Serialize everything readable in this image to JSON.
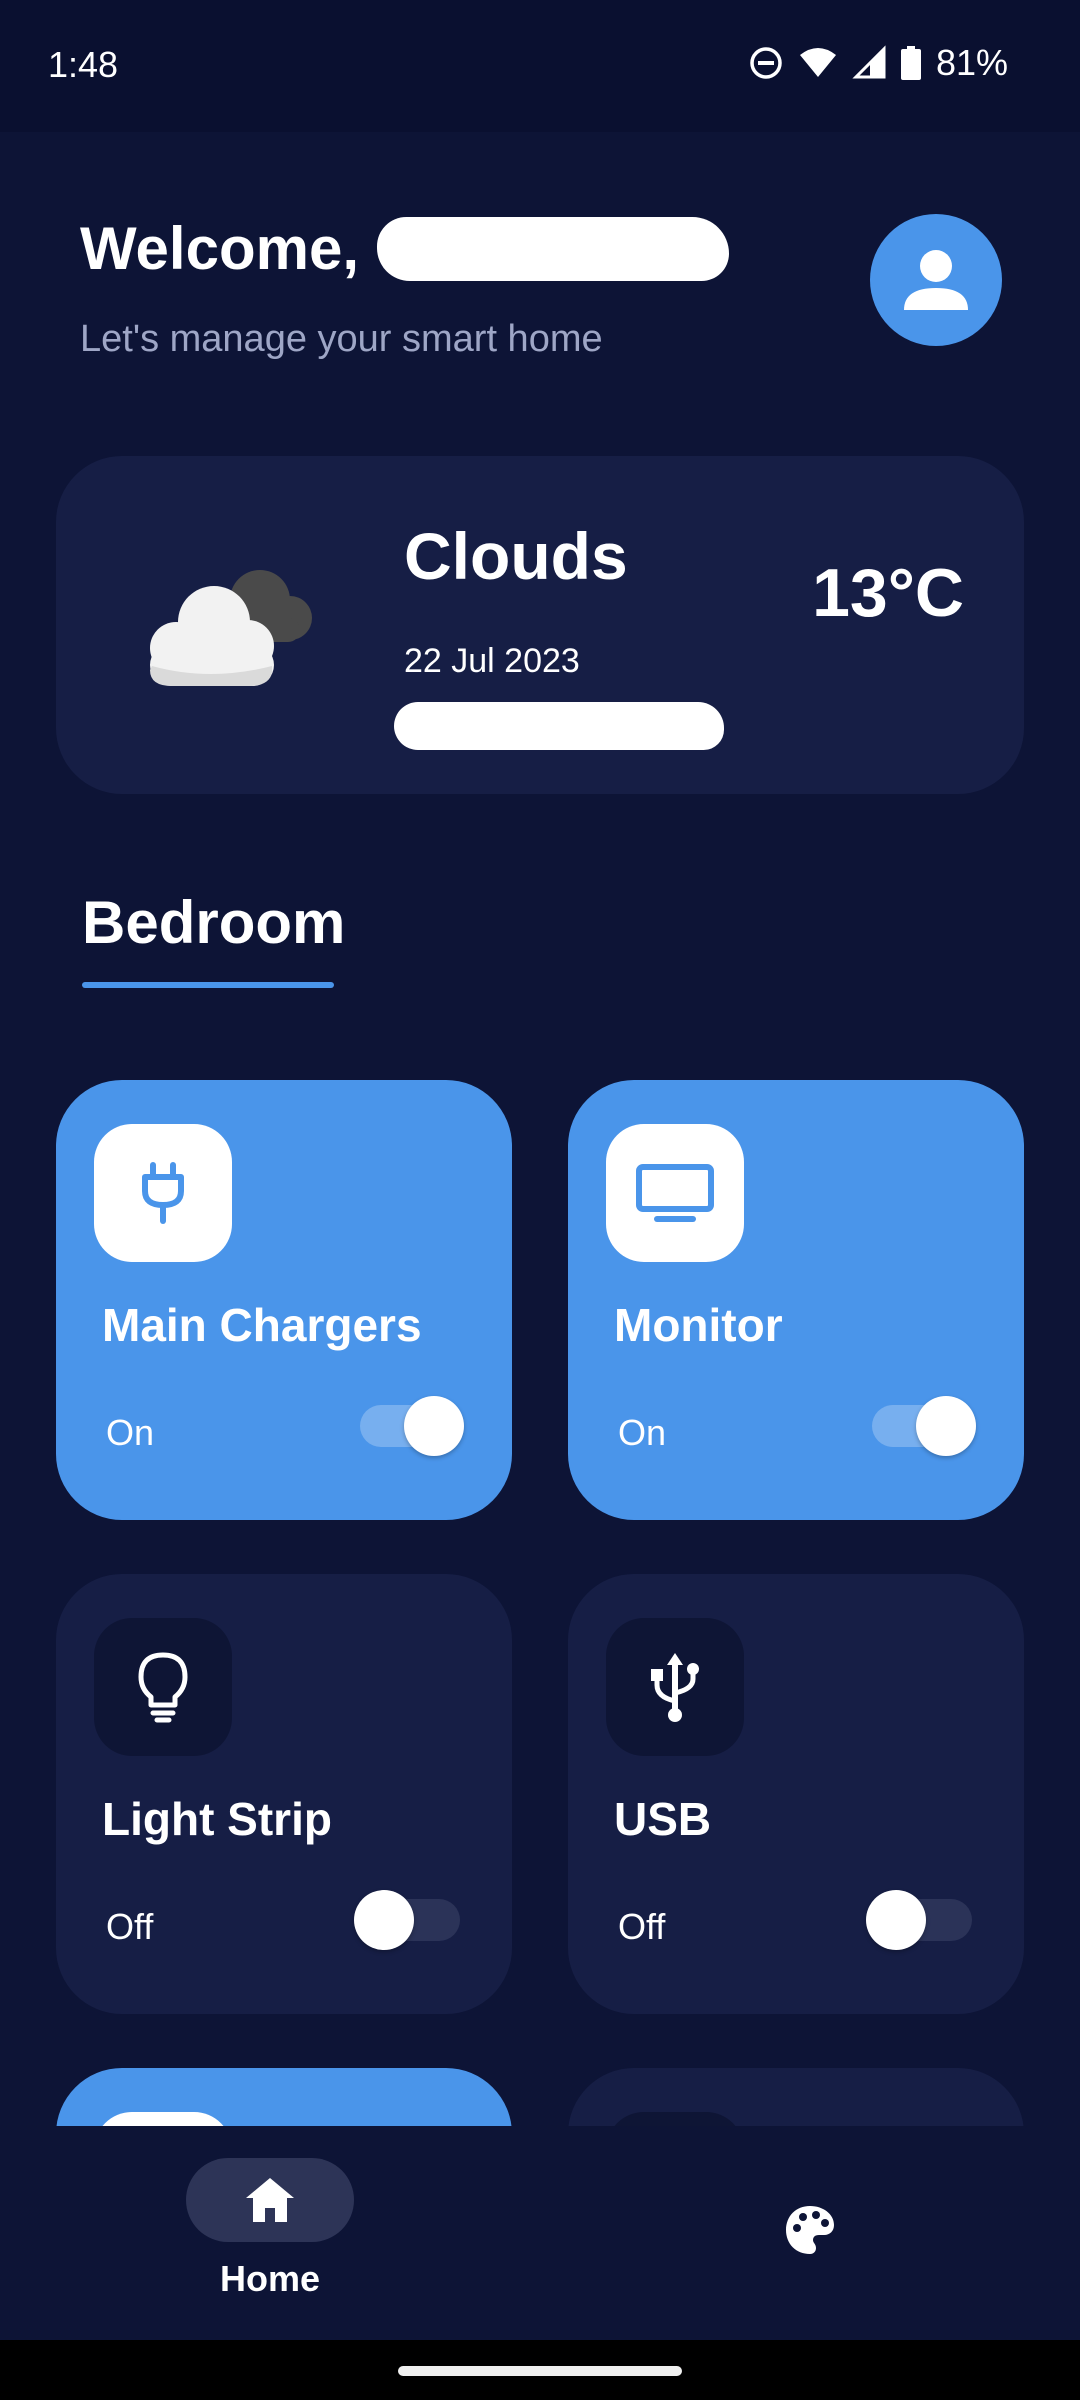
{
  "status_bar": {
    "time": "1:48",
    "battery": "81%"
  },
  "header": {
    "welcome": "Welcome,",
    "subtitle": "Let's manage your smart home"
  },
  "weather": {
    "condition": "Clouds",
    "date": "22 Jul 2023",
    "temperature": "13°C",
    "icon": "clouds-icon"
  },
  "room": {
    "name": "Bedroom"
  },
  "devices": [
    {
      "name": "Main Chargers",
      "state": "On",
      "on": true,
      "icon": "plug-icon"
    },
    {
      "name": "Monitor",
      "state": "On",
      "on": true,
      "icon": "monitor-icon"
    },
    {
      "name": "Light Strip",
      "state": "Off",
      "on": false,
      "icon": "lightbulb-icon"
    },
    {
      "name": "USB",
      "state": "Off",
      "on": false,
      "icon": "usb-icon"
    }
  ],
  "bottom_nav": {
    "home_label": "Home"
  },
  "colors": {
    "background": "#0d1436",
    "card": "#161e45",
    "accent": "#4a95ea",
    "muted_text": "#9ea6c6"
  }
}
